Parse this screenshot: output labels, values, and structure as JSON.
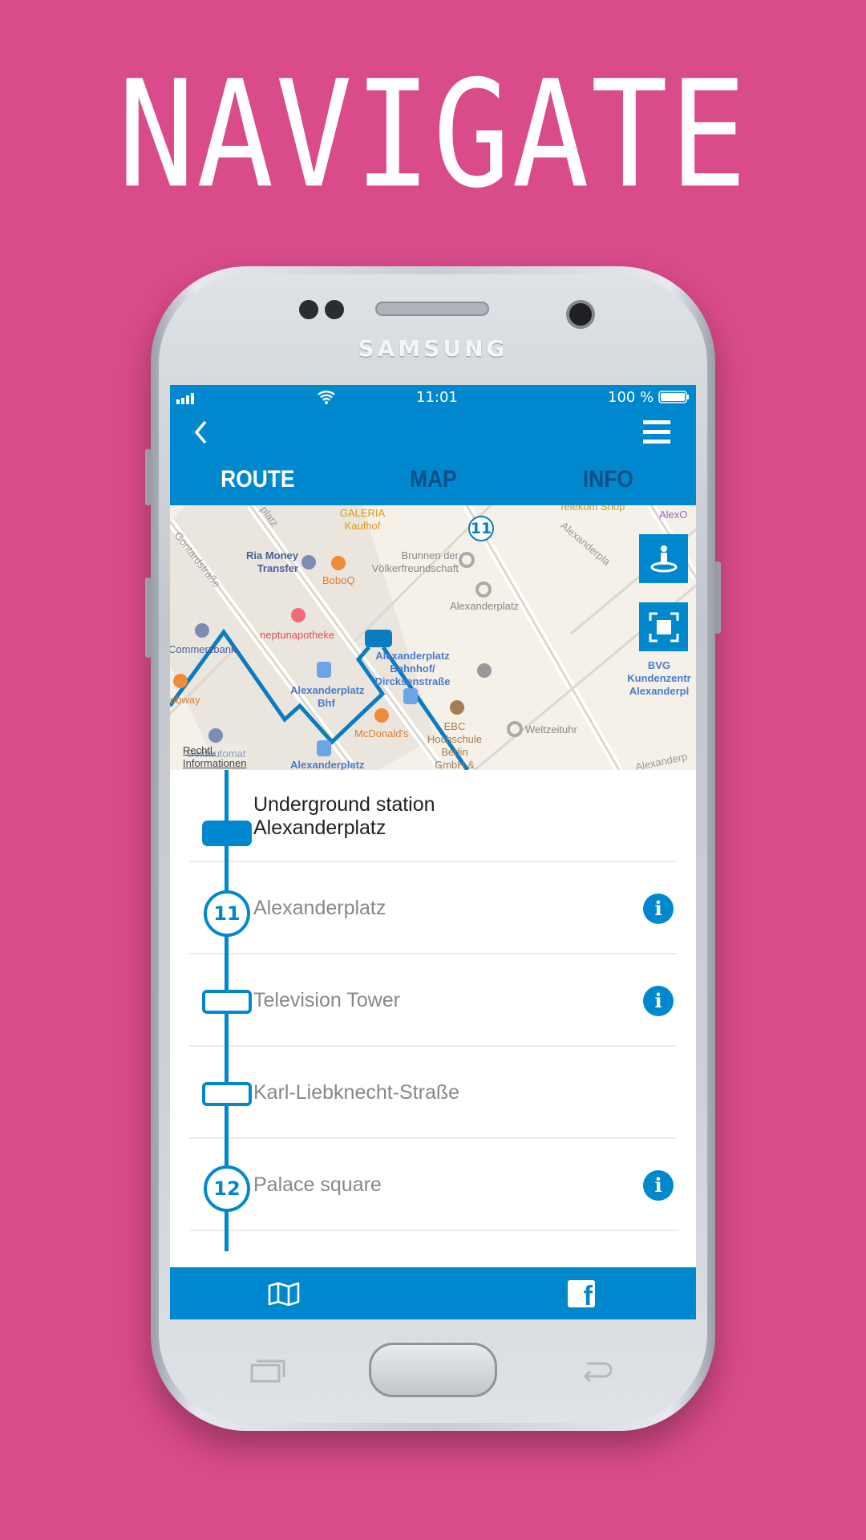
{
  "headline": "NAVIGATE",
  "device": {
    "brand": "SAMSUNG"
  },
  "status_bar": {
    "time": "11:01",
    "battery": "100 %"
  },
  "header": {
    "back_icon": "chevron-left-icon",
    "menu_icon": "hamburger-icon"
  },
  "tabs": [
    {
      "label": "ROUTE",
      "active": true
    },
    {
      "label": "MAP",
      "active": false
    },
    {
      "label": "INFO",
      "active": false
    }
  ],
  "map": {
    "labels": {
      "galeria": "GALERIA",
      "kaufhof": "Kaufhof",
      "telekom": "Telekom Shop",
      "alexo": "AlexO",
      "ria1": "Ria Money",
      "ria2": "Transfer",
      "boboq": "BoboQ",
      "brunnen1": "Brunnen der",
      "brunnen2": "Völkerfreundschaft",
      "alexplatz": "Alexanderplatz",
      "neptun": "neptunapotheke",
      "commerz": "Commerzbank",
      "subway": "ubway",
      "bhf1": "Alexanderplatz",
      "bhf2": "Bhf",
      "dirck1": "Alexanderplatz",
      "dirck2": "Bahnhof/",
      "dirck3": "Dircksenstraße",
      "bvg1": "BVG",
      "bvg2": "Kundenzentr",
      "bvg3": "Alexanderpl",
      "mcd": "McDonald's",
      "ebc1": "EBC",
      "ebc2": "Hochschule",
      "ebc3": "Berlin",
      "ebc4": "GmbH & Co",
      "welt": "Weltzeituhr",
      "geld": "Geldautomat",
      "alex_bottom": "Alexanderplatz",
      "gontard": "Gontardstraße",
      "alexstr": "Alexanderpla",
      "platz": "platz",
      "alexstr2": "Alexanderp"
    },
    "stop_badge": "11",
    "legal_link": "Rechtl. Informationen",
    "buttons": {
      "locate_icon": "person-location-icon",
      "fullscreen_icon": "fullscreen-icon"
    }
  },
  "route_stops": [
    {
      "name": "Underground station",
      "name2": "Alexanderplatz",
      "marker": "subway",
      "info": false
    },
    {
      "name": "Alexanderplatz",
      "marker": "11",
      "info": true
    },
    {
      "name": "Television Tower",
      "marker": "stop",
      "info": true
    },
    {
      "name": "Karl-Liebknecht-Straße",
      "marker": "stop",
      "info": false
    },
    {
      "name": "Palace square",
      "marker": "12",
      "info": true
    }
  ],
  "info_glyph": "i",
  "bottom_bar": {
    "left_icon": "map-icon",
    "right_icon": "facebook-icon",
    "facebook_glyph": "f"
  },
  "colors": {
    "background": "#d94b89",
    "primary": "#0088cf",
    "tab_inactive": "#0b4f86"
  }
}
